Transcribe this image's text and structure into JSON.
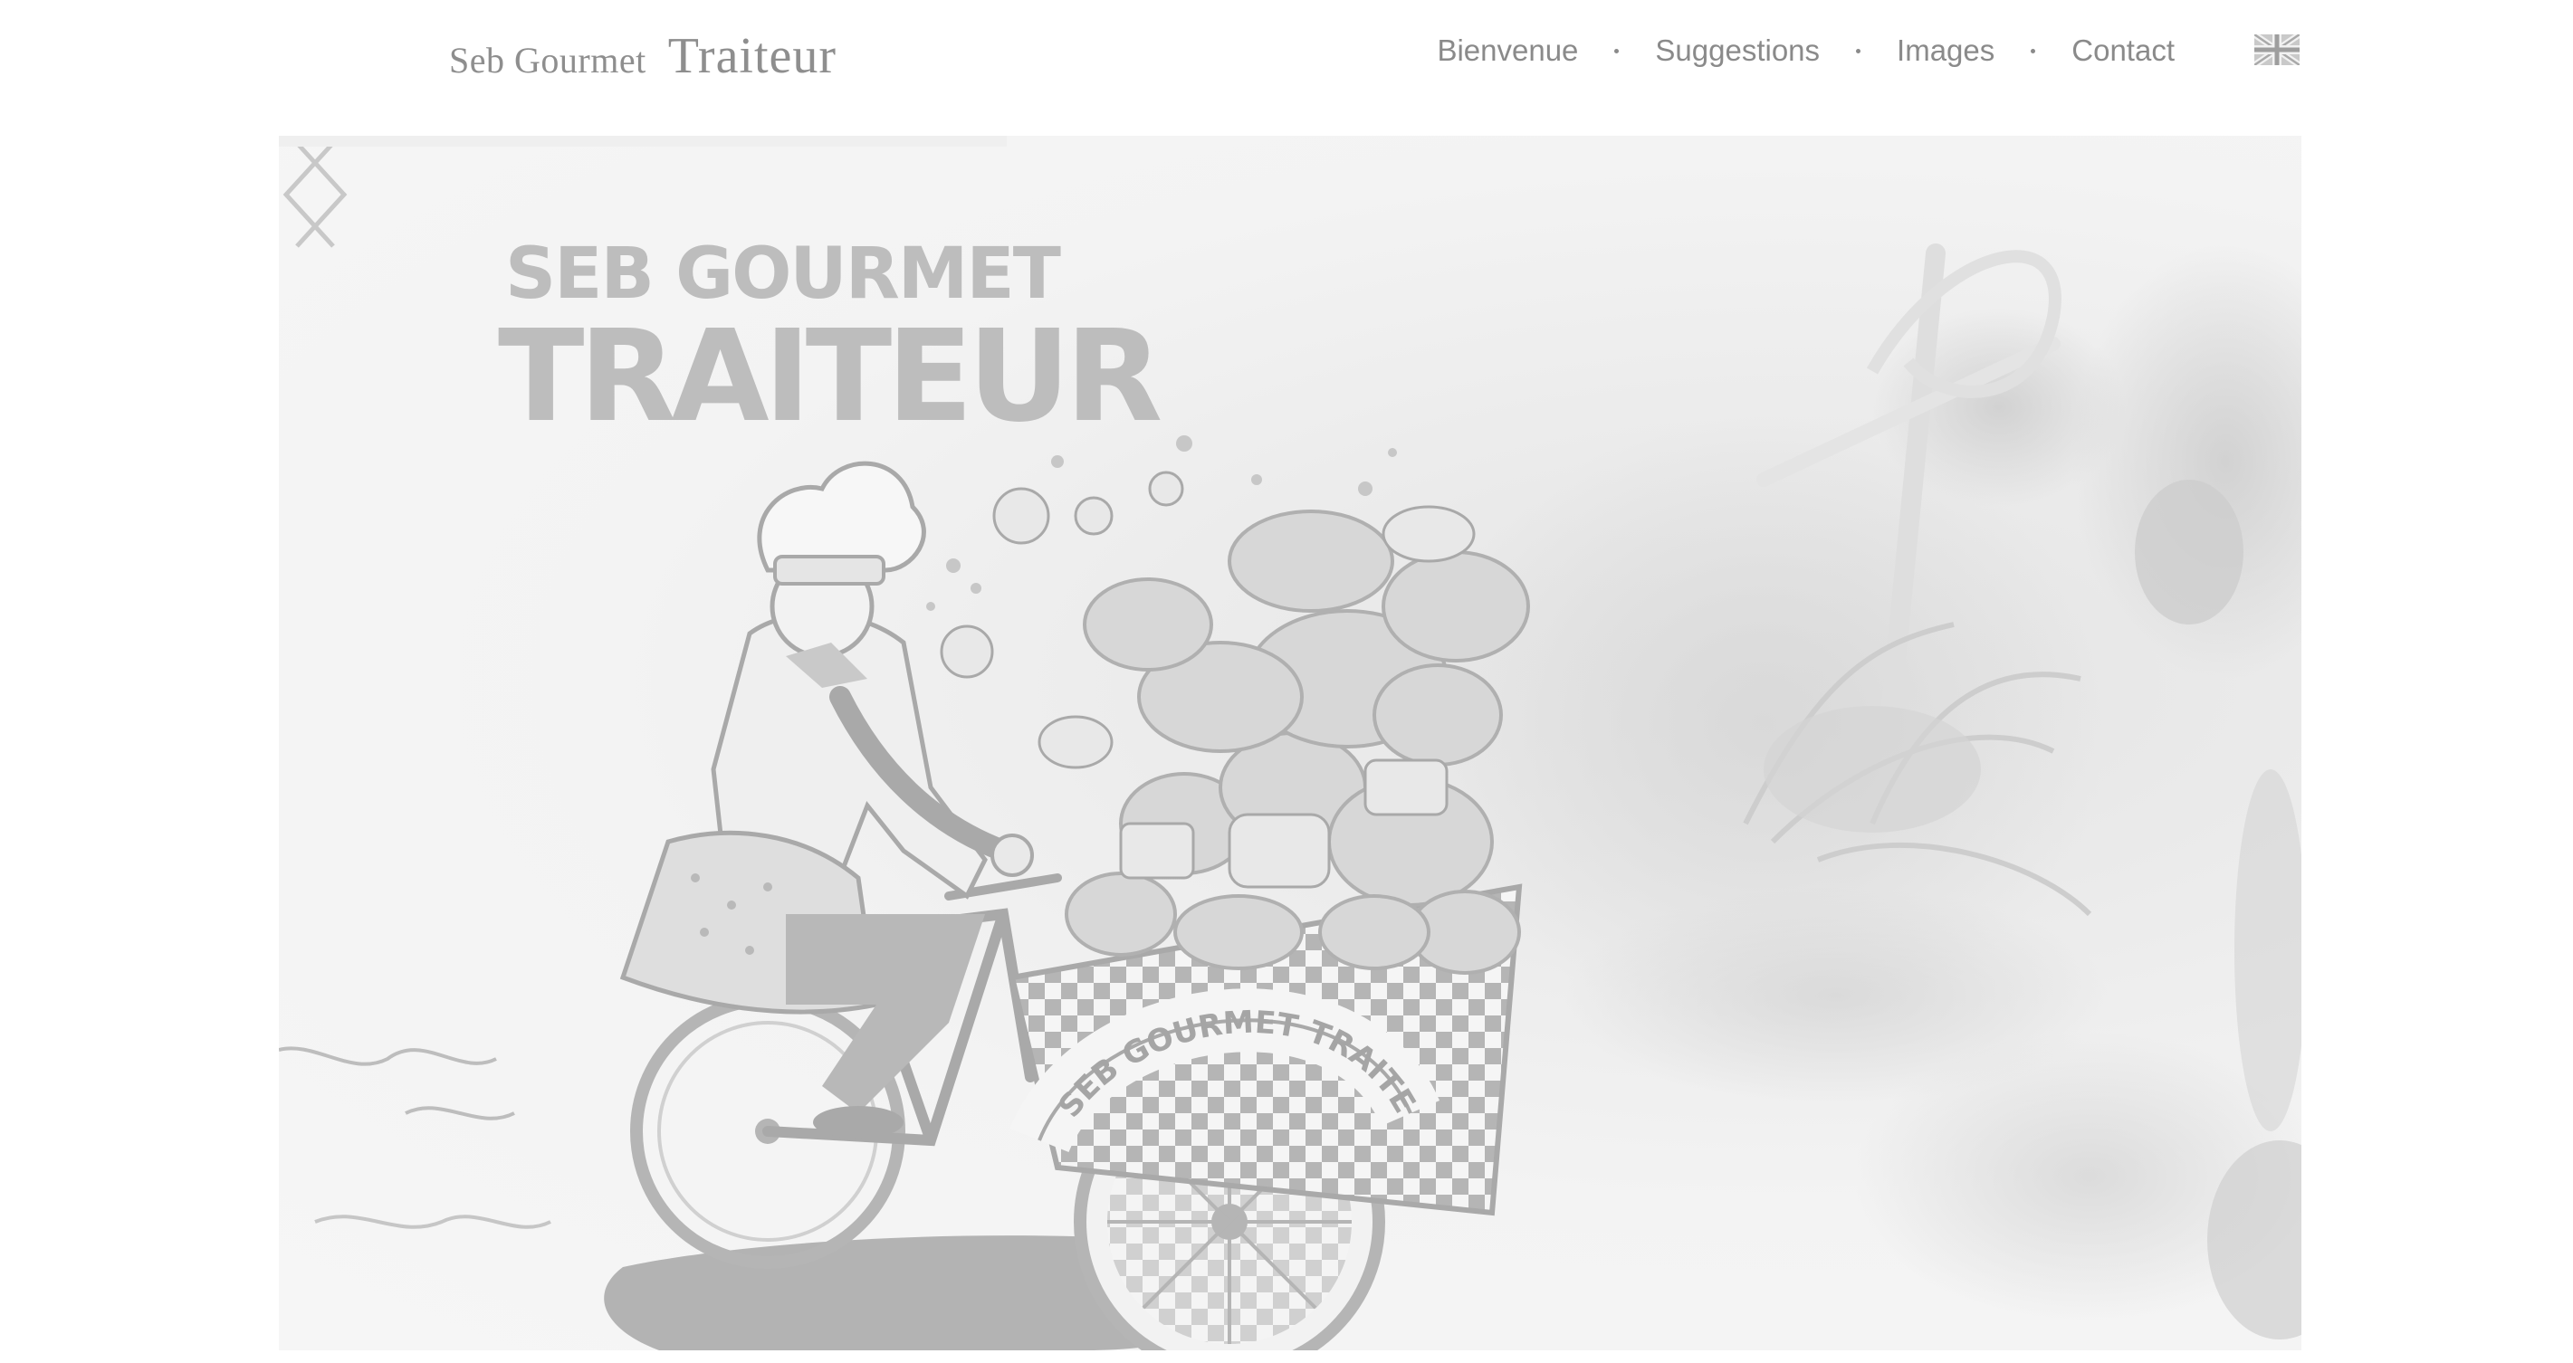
{
  "header": {
    "brand_small": "Seb Gourmet",
    "brand_large": "Traiteur",
    "nav": [
      "Bienvenue",
      "Suggestions",
      "Images",
      "Contact"
    ],
    "language_flag_icon": "uk-flag-icon"
  },
  "hero": {
    "title_line_1": "SEB GOURMET",
    "title_line_2": "TRAITEUR",
    "cart_lettering": "SEB GOURMET TRAITEUR",
    "prev_icon": "chevron-left-icon",
    "next_icon": "chevron-right-icon",
    "slide_progress": 0.36
  },
  "colors": {
    "text": "#8a8a8a",
    "hero_gray": "#bdbdbd",
    "hero_bg": "#f3f3f3"
  }
}
